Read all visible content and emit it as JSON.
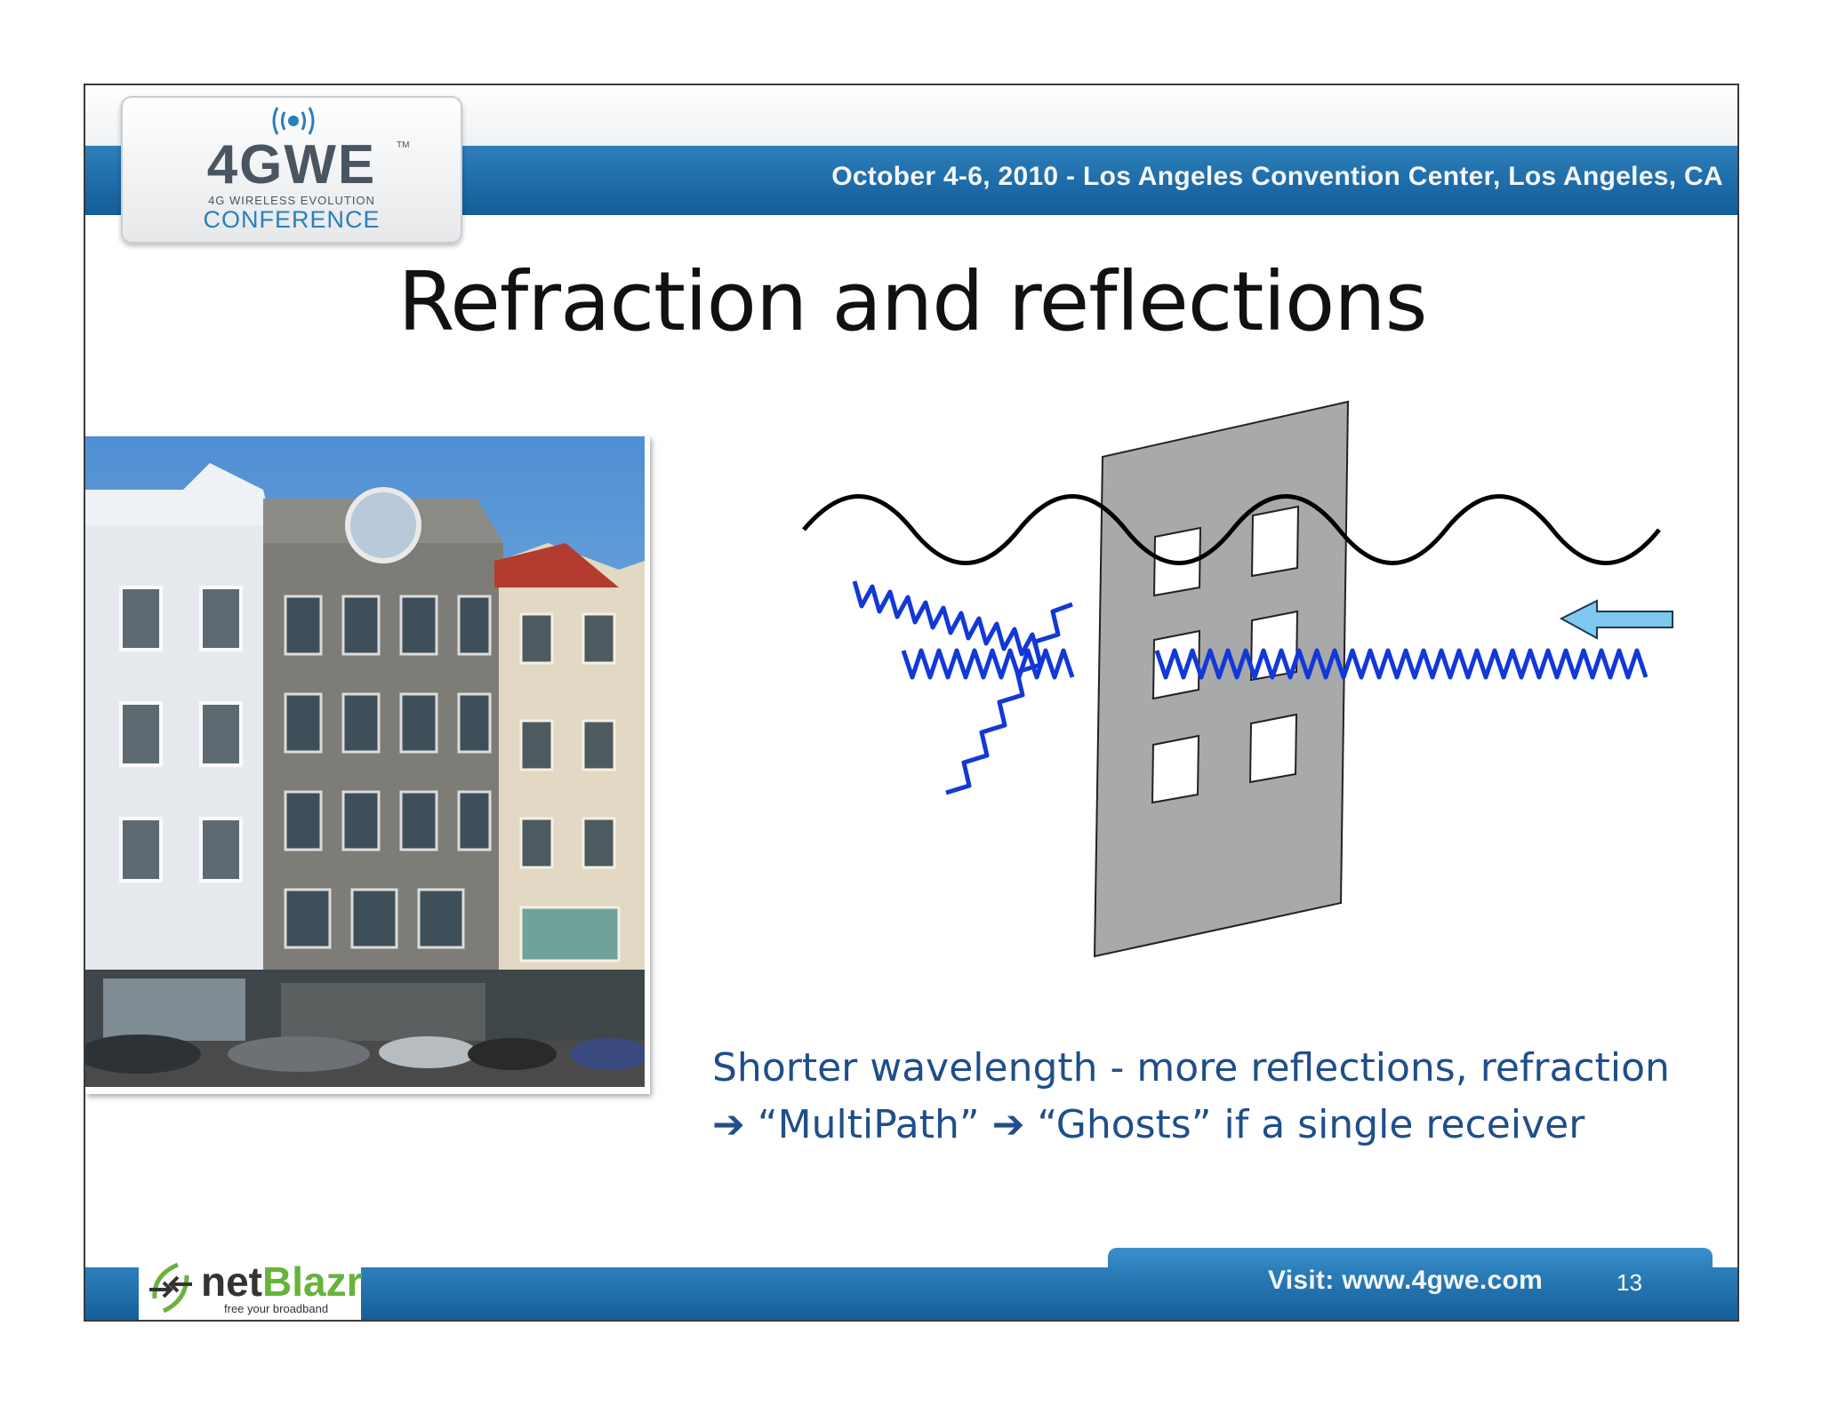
{
  "header": {
    "event_info": "October 4-6, 2010 - Los Angeles Convention Center, Los Angeles, CA"
  },
  "logo": {
    "main": "4GWE",
    "tm": "TM",
    "subtitle": "4G WIRELESS EVOLUTION",
    "conference": "CONFERENCE"
  },
  "slide": {
    "title": "Refraction and reflections",
    "caption_line1": "Shorter wavelength - more reflections, refraction",
    "caption_line2": "➔ “MultiPath” ➔ “Ghosts” if a single receiver"
  },
  "footer": {
    "visit": "Visit: www.4gwe.com",
    "page_number": "13",
    "sponsor_net": "net",
    "sponsor_blazr": "Blazr",
    "sponsor_tagline": "free your broadband"
  },
  "colors": {
    "header_blue": "#1c6aa7",
    "wave_blue": "#1238d6",
    "wave_black": "#000000",
    "arrow_fill": "#7fc8f0",
    "wall_gray": "#a9a9a9",
    "caption_blue": "#1f4e8a"
  }
}
